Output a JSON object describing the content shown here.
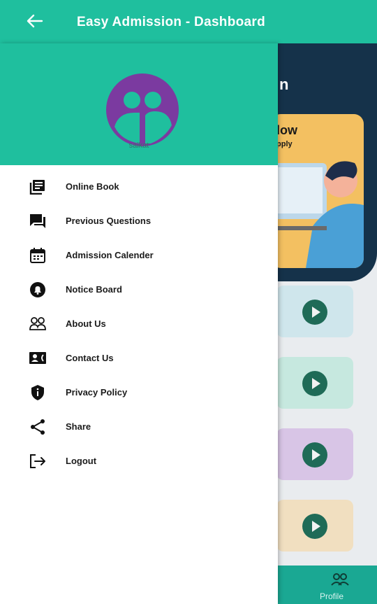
{
  "appbar": {
    "title": "Easy Admission - Dashboard",
    "back_icon": "arrow-left-icon"
  },
  "drawer": {
    "username": "saikat",
    "items": [
      {
        "label": "Online Book",
        "icon": "book-icon"
      },
      {
        "label": "Previous Questions",
        "icon": "chat-icon"
      },
      {
        "label": "Admission Calender",
        "icon": "calendar-icon"
      },
      {
        "label": "Notice Board",
        "icon": "bell-icon"
      },
      {
        "label": "About Us",
        "icon": "people-icon"
      },
      {
        "label": "Contact Us",
        "icon": "contact-card-icon"
      },
      {
        "label": "Privacy Policy",
        "icon": "shield-icon"
      },
      {
        "label": "Share",
        "icon": "share-icon"
      },
      {
        "label": "Logout",
        "icon": "logout-icon"
      }
    ]
  },
  "background": {
    "title_fragment": "n",
    "card_line1": "low",
    "card_line2": "pply",
    "bottom_nav_label": "Profile"
  },
  "colors": {
    "primary": "#1fbf9e",
    "avatar": "#7b3aa0",
    "dark_header": "#15324a"
  }
}
